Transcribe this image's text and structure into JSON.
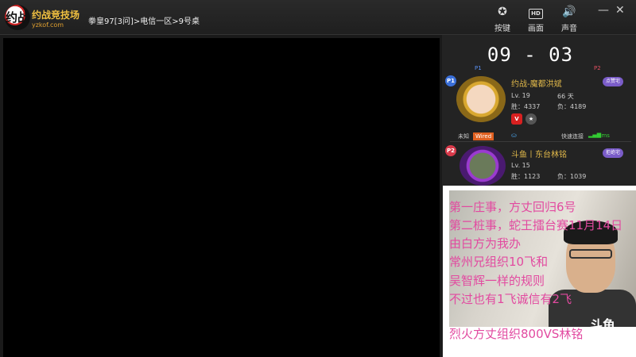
{
  "app": {
    "logo_text": "约战",
    "brand": "约战竞技场",
    "url": "yzkof.com",
    "breadcrumb": "拳皇97[3问]>电信一区>9号桌"
  },
  "toolbar": {
    "buttons": [
      {
        "label": "按键",
        "icon": "gamepad-icon"
      },
      {
        "label": "画面",
        "icon": "hd-icon",
        "icon_text": "HD"
      },
      {
        "label": "声音",
        "icon": "speaker-icon"
      }
    ],
    "minimize": "—",
    "close": "✕"
  },
  "match": {
    "score": "09 - 03",
    "p1_label": "P1",
    "p2_label": "P2"
  },
  "player1": {
    "badge": "P1",
    "name": "约战-魔都洪斌",
    "tag": "点赞宅",
    "level": "Lv. 19",
    "days": "66 天",
    "wins": "胜：4337",
    "losses": "负：4189",
    "status": "未知",
    "connection": "Wired",
    "quick_connect": "快速连接",
    "ping": "8ms"
  },
  "player2": {
    "badge": "P2",
    "name": "斗鱼丨东台林铭",
    "tag": "拒绝宅",
    "level": "Lv. 15",
    "wins": "胜：1123",
    "losses": "负：1039"
  },
  "overlay": {
    "lines": [
      "第一庄事，方丈回归6号",
      "第二桩事，蛇王擂台赛11月14日",
      "由白方为我办",
      "常州兄组织10飞和",
      "吴智辉一样的规则",
      "不过也有1飞诚信有2飞",
      "烈火方丈组织800VS林铭"
    ],
    "watermark": "斗鱼"
  },
  "colors": {
    "overlay_text": "#e24aa0",
    "name_gold": "#e0b84a",
    "p1_badge": "#3a6fd8",
    "p2_badge": "#d83a4a",
    "tag_purple": "#7a5cc8"
  }
}
